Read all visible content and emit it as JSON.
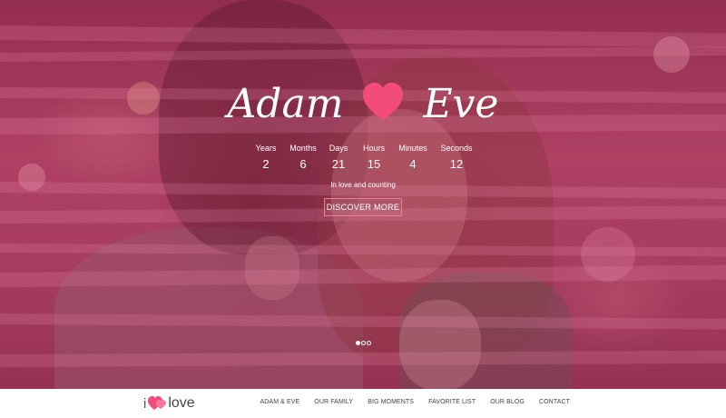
{
  "hero": {
    "title_left": "Adam",
    "title_right": "Eve",
    "heart_icon": "heart-icon",
    "countdown": [
      {
        "label": "Years",
        "value": "2"
      },
      {
        "label": "Months",
        "value": "6"
      },
      {
        "label": "Days",
        "value": "21"
      },
      {
        "label": "Hours",
        "value": "15"
      },
      {
        "label": "Minutes",
        "value": "4"
      },
      {
        "label": "Seconds",
        "value": "12"
      }
    ],
    "tagline": "In love and counting",
    "discover_label": "DISCOVER MORE",
    "slides": {
      "count": 3,
      "active": 1
    }
  },
  "navbar": {
    "brand_i": "i",
    "brand_love": "love",
    "items": [
      "ADAM & EVE",
      "OUR FAMILY",
      "BIG MOMENTS",
      "FAVORITE LIST",
      "OUR BLOG",
      "CONTACT"
    ]
  },
  "colors": {
    "accent": "#f24c7c",
    "overlay": "#aa285a"
  }
}
